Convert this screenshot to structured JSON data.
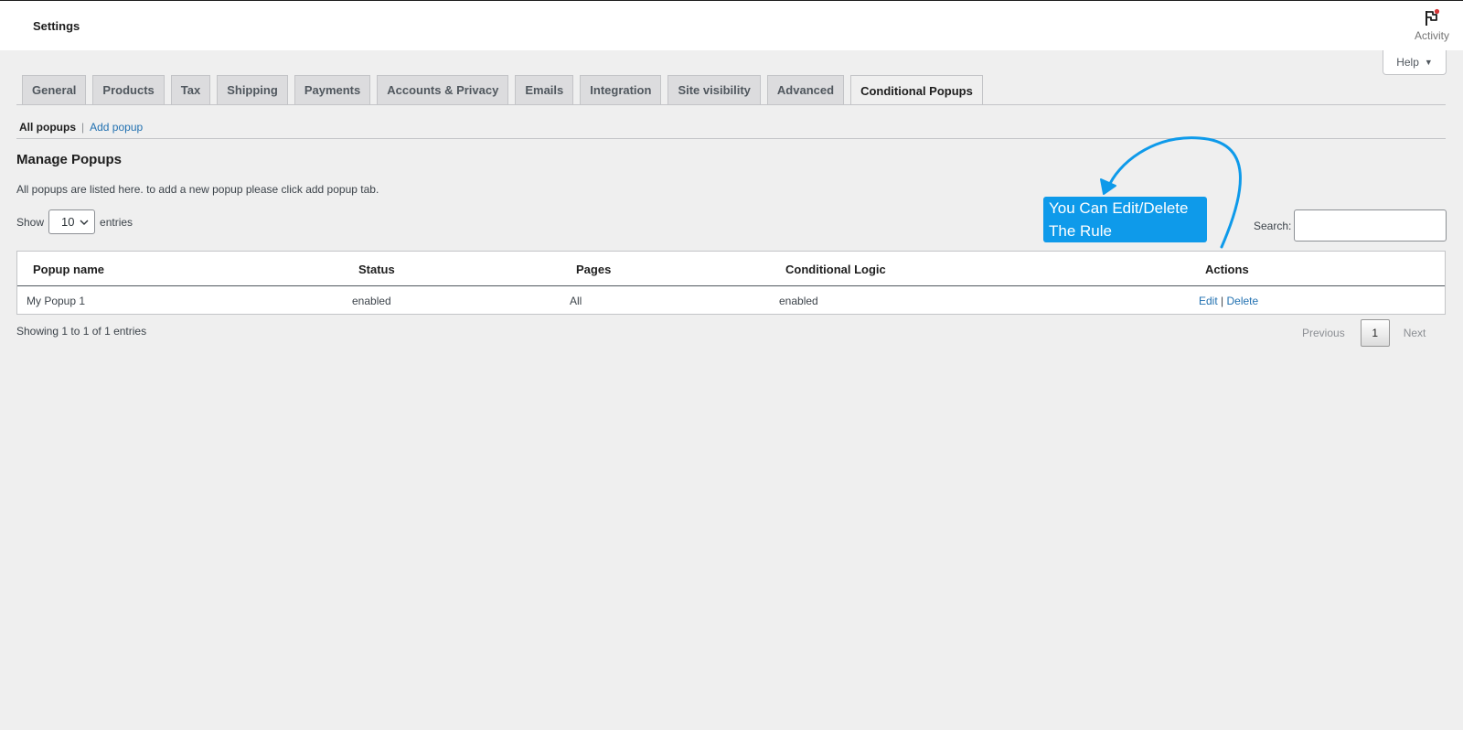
{
  "header": {
    "title": "Settings",
    "activity_label": "Activity"
  },
  "help": {
    "label": "Help"
  },
  "tabs": [
    {
      "label": "General",
      "active": false
    },
    {
      "label": "Products",
      "active": false
    },
    {
      "label": "Tax",
      "active": false
    },
    {
      "label": "Shipping",
      "active": false
    },
    {
      "label": "Payments",
      "active": false
    },
    {
      "label": "Accounts & Privacy",
      "active": false
    },
    {
      "label": "Emails",
      "active": false
    },
    {
      "label": "Integration",
      "active": false
    },
    {
      "label": "Site visibility",
      "active": false
    },
    {
      "label": "Advanced",
      "active": false
    },
    {
      "label": "Conditional Popups",
      "active": true
    }
  ],
  "subnav": {
    "current": "All popups",
    "separator": "|",
    "add": "Add popup"
  },
  "section": {
    "title": "Manage Popups",
    "description": "All popups are listed here. to add a new popup please click add popup tab."
  },
  "length": {
    "show_label": "Show",
    "value": "10",
    "entries_label": "entries"
  },
  "search": {
    "label": "Search:",
    "value": ""
  },
  "table": {
    "columns": [
      "Popup name",
      "Status",
      "Pages",
      "Conditional Logic",
      "Actions"
    ],
    "rows": [
      {
        "name": "My Popup 1",
        "status": "enabled",
        "pages": "All",
        "logic": "enabled",
        "edit": "Edit",
        "sep": "|",
        "delete": "Delete"
      }
    ]
  },
  "info": "Showing 1 to 1 of 1 entries",
  "pagination": {
    "previous": "Previous",
    "page": "1",
    "next": "Next"
  },
  "annotation": {
    "line1": "You Can Edit/Delete",
    "line2": "The Rule",
    "color": "#0e9aea"
  },
  "colors": {
    "link": "#2271b1",
    "background": "#efefef",
    "activity_dot": "#d63638"
  }
}
